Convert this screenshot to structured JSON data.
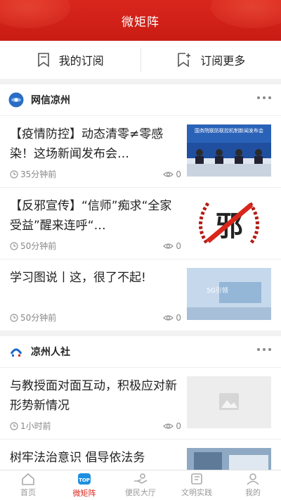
{
  "header": {
    "title": "微矩阵"
  },
  "subscribe": {
    "mine_label": "我的订阅",
    "more_label": "订阅更多"
  },
  "sections": [
    {
      "name": "网信凉州",
      "items": [
        {
          "title": "【疫情防控】动态清零≠零感染！这场新闻发布会…",
          "time": "35分钟前",
          "views": "0"
        },
        {
          "title": "【反邪宣传】“信师”痴求“全家受益”醒来连呼“…",
          "time": "50分钟前",
          "views": "0"
        },
        {
          "title": "学习图说丨这，很了不起!",
          "time": "50分钟前",
          "views": "0"
        }
      ]
    },
    {
      "name": "凉州人社",
      "items": [
        {
          "title": "与教授面对面互动，积极应对新形势新情况",
          "time": "1小时前",
          "views": "0"
        },
        {
          "title": "树牢法治意识 倡导依法务",
          "time": "",
          "views": ""
        }
      ]
    }
  ],
  "thumb_text": {
    "press": "国务院联防联控机制新闻发布会",
    "evil": "邪",
    "banner": "5G引领"
  },
  "tabs": [
    {
      "label": "首页",
      "icon": "home-icon"
    },
    {
      "label": "微矩阵",
      "icon": "matrix-icon",
      "active": true
    },
    {
      "label": "便民大厅",
      "icon": "hand-icon"
    },
    {
      "label": "文明实践",
      "icon": "flag-icon"
    },
    {
      "label": "我的",
      "icon": "user-icon"
    }
  ],
  "colors": {
    "brand_red": "#d9261c",
    "meta_gray": "#888888"
  }
}
